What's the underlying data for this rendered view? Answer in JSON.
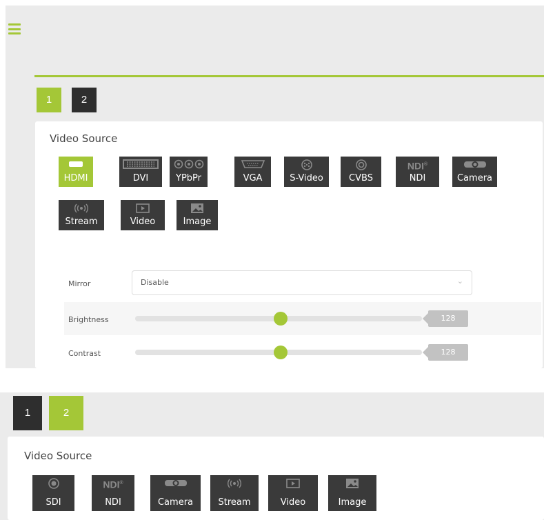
{
  "colors": {
    "accent": "#a4c737",
    "tile": "#3a3a3a",
    "panel": "#ebebeb",
    "value_badge": "#c2c2c2"
  },
  "top_panel": {
    "menu_icon": "hamburger-icon",
    "tabs": [
      {
        "label": "1",
        "active": true
      },
      {
        "label": "2",
        "active": false
      }
    ],
    "card": {
      "title": "Video Source",
      "sources": [
        {
          "label": "HDMI",
          "icon": "hdmi-icon",
          "active": true
        },
        {
          "label": "DVI",
          "icon": "dvi-icon",
          "active": false
        },
        {
          "label": "YPbPr",
          "icon": "ypbpr-icon",
          "active": false
        },
        {
          "label": "VGA",
          "icon": "vga-icon",
          "active": false
        },
        {
          "label": "S-Video",
          "icon": "svideo-icon",
          "active": false
        },
        {
          "label": "CVBS",
          "icon": "cvbs-icon",
          "active": false
        },
        {
          "label": "NDI",
          "icon": "ndi-icon",
          "active": false
        },
        {
          "label": "Camera",
          "icon": "camera-icon",
          "active": false
        },
        {
          "label": "Stream",
          "icon": "stream-icon",
          "active": false
        },
        {
          "label": "Video",
          "icon": "video-icon",
          "active": false
        },
        {
          "label": "Image",
          "icon": "image-icon",
          "active": false
        }
      ],
      "mirror": {
        "label": "Mirror",
        "value": "Disable"
      },
      "brightness": {
        "label": "Brightness",
        "value": "128",
        "fraction": 0.5
      },
      "contrast": {
        "label": "Contrast",
        "value": "128",
        "fraction": 0.5
      }
    }
  },
  "bottom_panel": {
    "tabs": [
      {
        "label": "1",
        "active": false
      },
      {
        "label": "2",
        "active": true
      }
    ],
    "card": {
      "title": "Video Source",
      "sources": [
        {
          "label": "SDI",
          "icon": "sdi-icon"
        },
        {
          "label": "NDI",
          "icon": "ndi-icon"
        },
        {
          "label": "Camera",
          "icon": "camera-icon"
        },
        {
          "label": "Stream",
          "icon": "stream-icon"
        },
        {
          "label": "Video",
          "icon": "video-icon"
        },
        {
          "label": "Image",
          "icon": "image-icon"
        }
      ]
    }
  }
}
